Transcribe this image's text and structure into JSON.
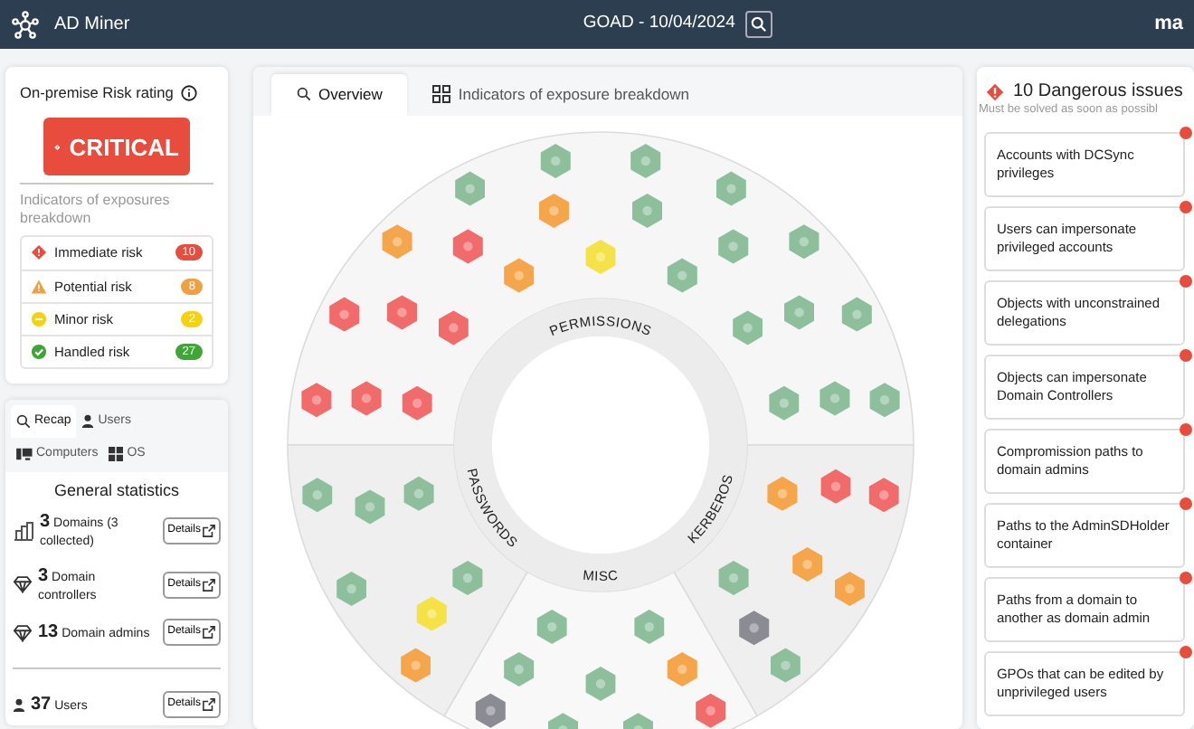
{
  "navbar": {
    "brand": "AD Miner",
    "title": "GOAD - 10/04/2024",
    "partner": "ma"
  },
  "risk_rating": {
    "title": "On-premise Risk rating",
    "rating": "CRITICAL",
    "breakdown_label": "Indicators of exposures breakdown",
    "levels": [
      {
        "kind": "immediate",
        "label": "Immediate risk",
        "count": "10"
      },
      {
        "kind": "potential",
        "label": "Potential risk",
        "count": "8"
      },
      {
        "kind": "minor",
        "label": "Minor risk",
        "count": "2"
      },
      {
        "kind": "handled",
        "label": "Handled risk",
        "count": "27"
      }
    ]
  },
  "stats": {
    "tabs": [
      {
        "kind": "search",
        "label": "Recap",
        "selected": true
      },
      {
        "kind": "user",
        "label": "Users",
        "selected": false
      },
      {
        "kind": "computer",
        "label": "Computers",
        "selected": false
      },
      {
        "kind": "os",
        "label": "OS",
        "selected": false
      }
    ],
    "title": "General statistics",
    "rows": [
      {
        "kind": "domain",
        "value": "3",
        "label": "Domains (3 collected)",
        "button": "Details"
      },
      {
        "kind": "diamond",
        "value": "3",
        "label": "Domain controllers",
        "button": "Details"
      },
      {
        "kind": "diamond",
        "value": "13",
        "label": "Domain admins",
        "button": "Details"
      },
      {
        "kind": "user",
        "value": "37",
        "label": "Users",
        "button": "Details"
      }
    ]
  },
  "overview": {
    "tabs": [
      {
        "kind": "search",
        "label": "Overview",
        "selected": true
      },
      {
        "kind": "grid",
        "label": "Indicators of exposure breakdown",
        "selected": false
      }
    ],
    "sectors": [
      {
        "kind": "permissions",
        "label": "PERMISSIONS",
        "indicators": [
          {
            "kind": "immediate"
          },
          {
            "kind": "immediate"
          },
          {
            "kind": "potential"
          },
          {
            "kind": "minor"
          },
          {
            "kind": "handled"
          },
          {
            "kind": "handled"
          },
          {
            "kind": "handled"
          },
          {
            "kind": "immediate"
          },
          {
            "kind": "immediate"
          },
          {
            "kind": "immediate"
          },
          {
            "kind": "potential"
          },
          {
            "kind": "handled"
          },
          {
            "kind": "handled"
          },
          {
            "kind": "handled"
          },
          {
            "kind": "handled"
          },
          {
            "kind": "immediate"
          },
          {
            "kind": "immediate"
          },
          {
            "kind": "potential"
          },
          {
            "kind": "handled"
          },
          {
            "kind": "handled"
          },
          {
            "kind": "handled"
          },
          {
            "kind": "handled"
          },
          {
            "kind": "handled"
          },
          {
            "kind": "handled"
          },
          {
            "kind": "handled"
          }
        ]
      },
      {
        "kind": "kerberos",
        "label": "KERBEROS",
        "indicators": [
          {
            "kind": "potential"
          },
          {
            "kind": "handled"
          },
          {
            "kind": "immediate"
          },
          {
            "kind": "potential"
          },
          {
            "kind": "inactive"
          },
          {
            "kind": "immediate"
          },
          {
            "kind": "potential"
          },
          {
            "kind": "handled"
          }
        ]
      },
      {
        "kind": "misc",
        "label": "MISC",
        "indicators": [
          {
            "kind": "handled"
          },
          {
            "kind": "handled"
          },
          {
            "kind": "potential"
          },
          {
            "kind": "handled"
          },
          {
            "kind": "handled"
          },
          {
            "kind": "immediate"
          },
          {
            "kind": "handled"
          },
          {
            "kind": "handled"
          },
          {
            "kind": "inactive"
          }
        ]
      },
      {
        "kind": "passwords",
        "label": "PASSWORDS",
        "indicators": [
          {
            "kind": "handled"
          },
          {
            "kind": "handled"
          },
          {
            "kind": "minor"
          },
          {
            "kind": "handled"
          },
          {
            "kind": "potential"
          },
          {
            "kind": "handled"
          },
          {
            "kind": "handled"
          }
        ]
      }
    ]
  },
  "issues": {
    "title": "10 Dangerous issues",
    "subtitle": "Must be solved as soon as possibl",
    "items": [
      "Accounts with DCSync privileges",
      "Users can impersonate privileged accounts",
      "Objects with unconstrained delegations",
      "Objects can impersonate Domain Controllers",
      "Compromission paths to domain admins",
      "Paths to the AdminSDHolder container",
      "Paths from a domain to another as domain admin",
      "GPOs that can be edited by unprivileged users"
    ]
  }
}
